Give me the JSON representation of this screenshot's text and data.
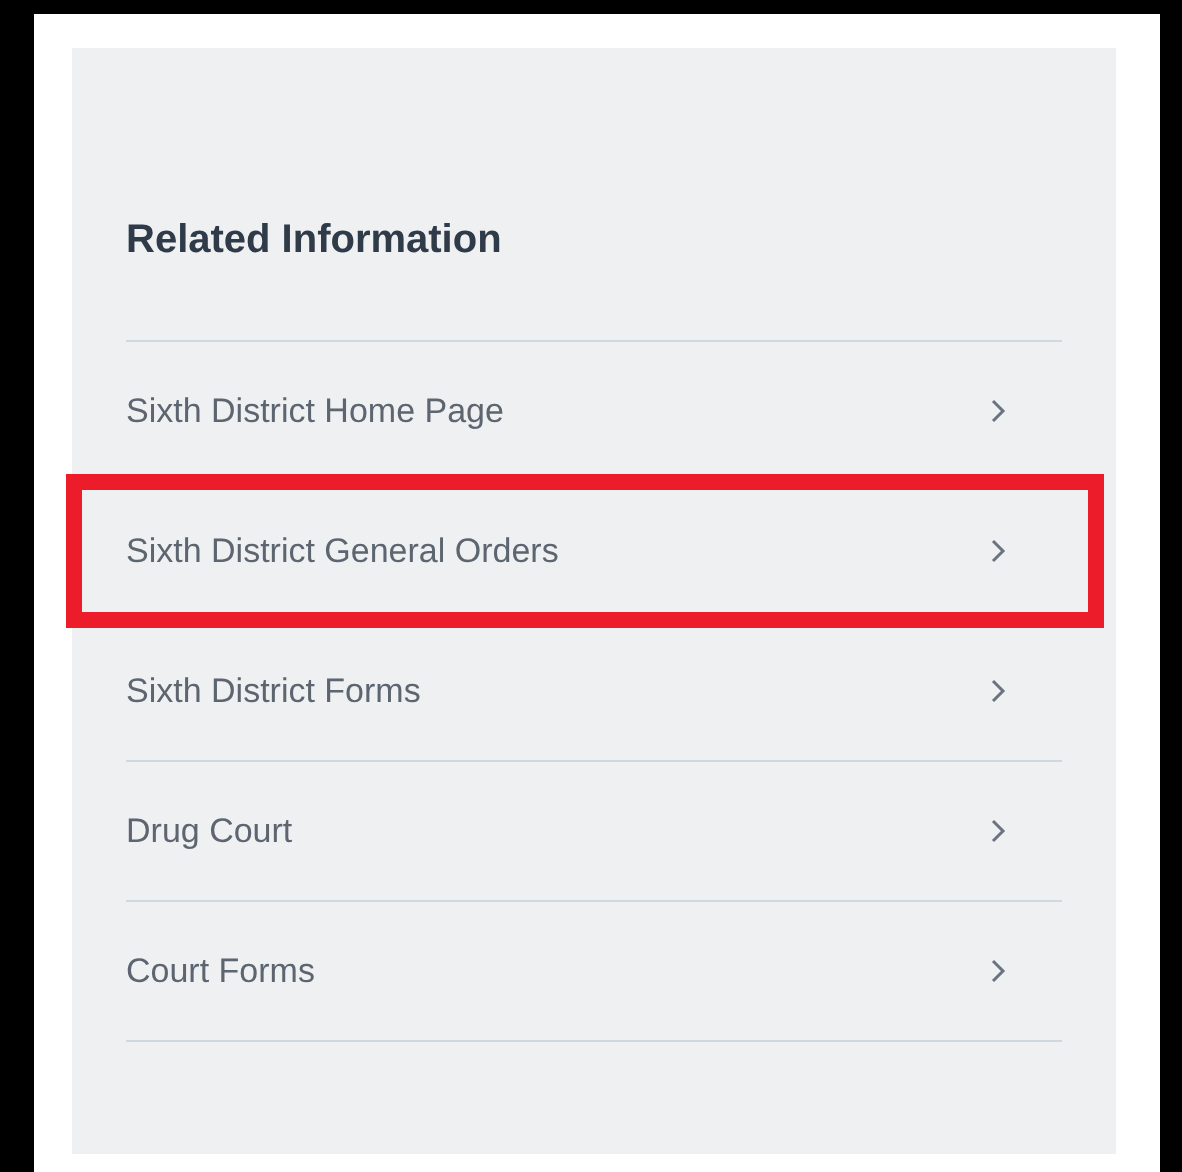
{
  "panel": {
    "title": "Related Information",
    "links": [
      {
        "label": "Sixth District Home Page",
        "highlighted": false
      },
      {
        "label": "Sixth District General Orders",
        "highlighted": true
      },
      {
        "label": "Sixth District Forms",
        "highlighted": false
      },
      {
        "label": "Drug Court",
        "highlighted": false
      },
      {
        "label": "Court Forms",
        "highlighted": false
      }
    ]
  }
}
